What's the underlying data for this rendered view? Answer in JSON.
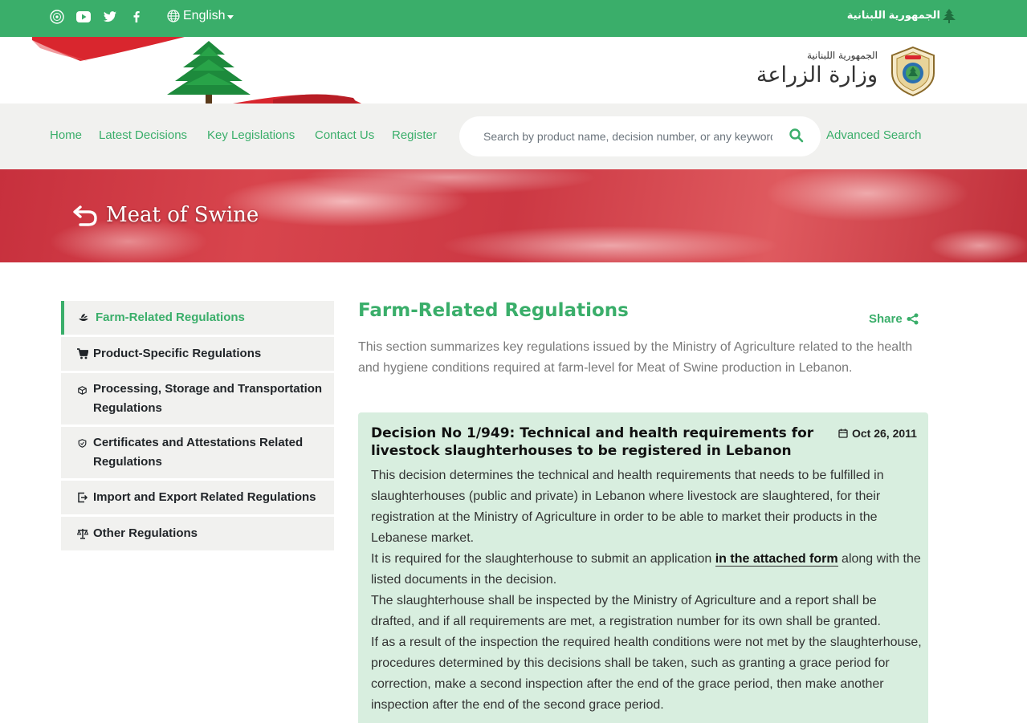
{
  "topbar": {
    "social": [
      {
        "name": "ministry-seal-icon"
      },
      {
        "name": "youtube-icon"
      },
      {
        "name": "twitter-icon"
      },
      {
        "name": "facebook-icon"
      }
    ],
    "language": "English",
    "republic": "الجمهورية اللبنانية"
  },
  "header": {
    "republic_small": "الجمهورية اللبنانية",
    "ministry": "وزارة الزراعة"
  },
  "nav": {
    "items": [
      {
        "label": "Home"
      },
      {
        "label": "Latest Decisions"
      },
      {
        "label": "Key Legislations"
      },
      {
        "label": "Contact Us"
      },
      {
        "label": "Register"
      }
    ],
    "search_placeholder": "Search by product name, decision number, or any keyword",
    "advanced_search": "Advanced Search"
  },
  "banner": {
    "title": "Meat of Swine"
  },
  "sidebar": {
    "items": [
      {
        "label": "Farm-Related Regulations",
        "icon": "farm-icon"
      },
      {
        "label": "Product-Specific Regulations",
        "icon": "cart-icon"
      },
      {
        "label": "Processing, Storage and Transportation Regulations",
        "icon": "box-icon"
      },
      {
        "label": "Certificates and Attestations Related Regulations",
        "icon": "shield-icon"
      },
      {
        "label": "Import and Export Related Regulations",
        "icon": "import-export-icon"
      },
      {
        "label": "Other Regulations",
        "icon": "scale-icon"
      }
    ]
  },
  "main": {
    "title": "Farm-Related Regulations",
    "share": "Share",
    "intro": "This section summarizes key regulations issued by the Ministry of Agriculture related to the health and hygiene conditions required at farm-level for Meat of Swine production in Lebanon.",
    "decision": {
      "title": "Decision No 1/949: Technical and health requirements for livestock slaughterhouses to be registered in Lebanon",
      "date": "Oct 26, 2011",
      "p1": "This decision determines the technical and health requirements that needs to be fulfilled in slaughterhouses (public and private) in Lebanon where livestock are slaughtered, for their registration at the Ministry of Agriculture in order to be able to market their products in the Lebanese market.",
      "p2_before": "It is required for the slaughterhouse to submit an application ",
      "p2_link": "in the attached form",
      "p2_after": " along with the listed documents in the decision.",
      "p3": "The slaughterhouse shall be inspected by the Ministry of Agriculture and a report shall be drafted, and if all requirements are met, a registration number for its own shall be granted.",
      "p4": "If as a result of the inspection the required health conditions were not met by the slaughterhouse, procedures determined by this decisions shall be taken, such as granting a grace period for correction, make a second inspection after the end of the grace period, then make another inspection after the end of the second grace period."
    }
  },
  "colors": {
    "brand_green": "#3aae6a",
    "nav_bg": "#f1f1ef",
    "card_bg": "#d8eedf"
  }
}
